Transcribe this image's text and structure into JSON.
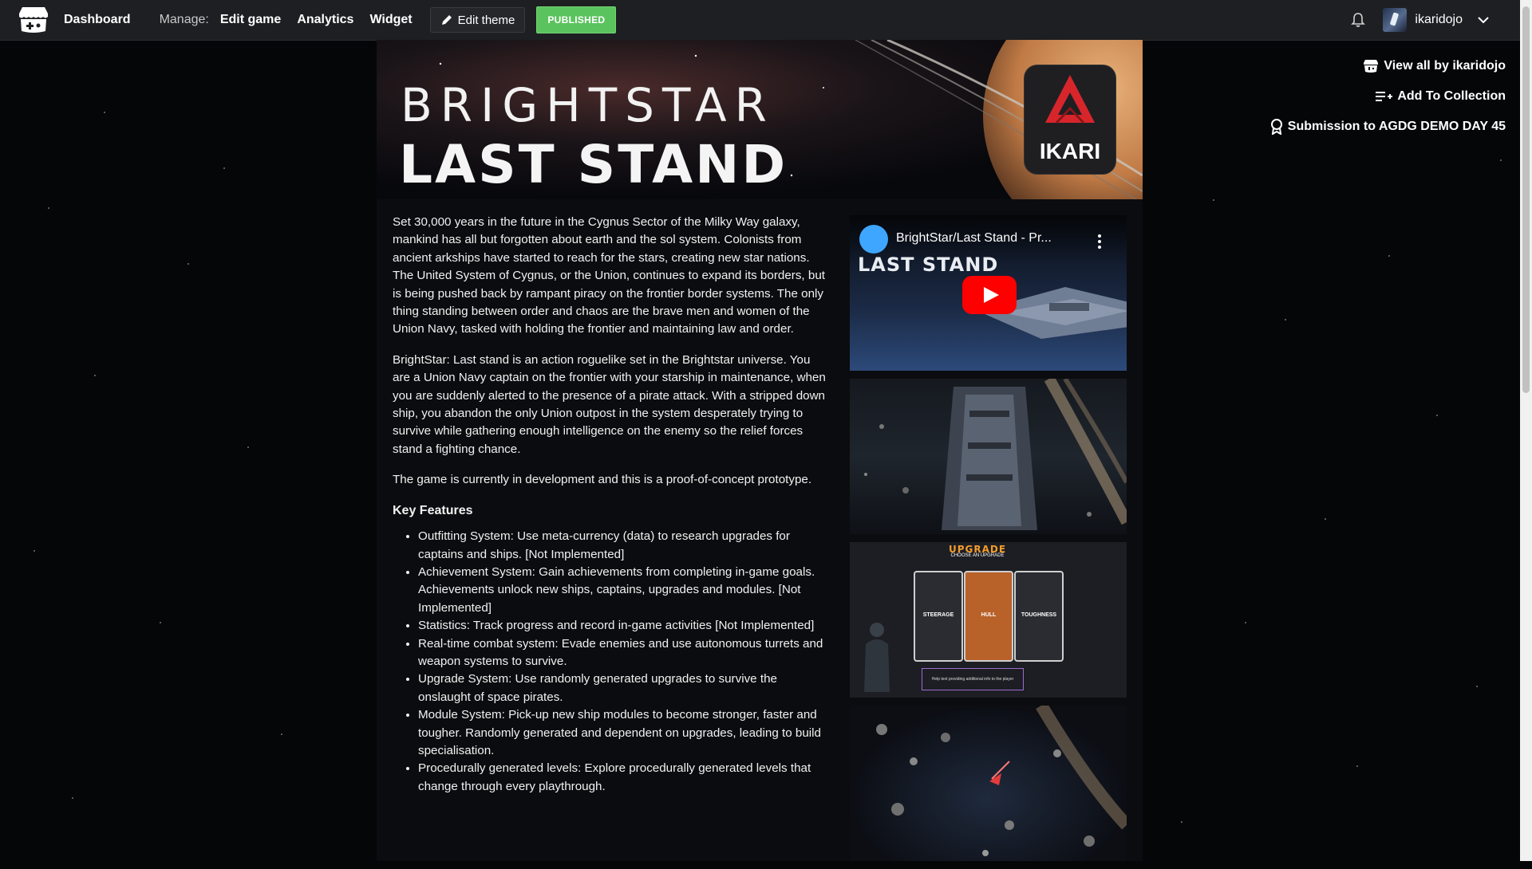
{
  "topbar": {
    "dashboard": "Dashboard",
    "manage_label": "Manage:",
    "edit_game": "Edit game",
    "analytics": "Analytics",
    "widget": "Widget",
    "edit_theme": "Edit theme",
    "status_badge": "PUBLISHED",
    "username": "ikaridojo"
  },
  "side_links": {
    "view_all": "View all by ikaridojo",
    "add_collection": "Add To Collection",
    "submission": "Submission to AGDG DEMO DAY 45"
  },
  "banner": {
    "line1": "BRIGHTSTAR",
    "line2": "LAST STAND",
    "studio": "IKARI"
  },
  "description": {
    "p1": "Set 30,000 years in the future in the Cygnus Sector of the Milky Way galaxy, mankind has all but forgotten about earth and the sol system. Colonists from ancient arkships have started to reach for the stars, creating new star nations. The United System of Cygnus, or the Union, continues to expand its borders, but is being pushed back by rampant piracy on the frontier border systems. The only thing standing between order and chaos are the brave men and women of the Union Navy, tasked with holding the frontier and maintaining law and order.",
    "p2": "BrightStar: Last stand is an action roguelike set in the Brightstar universe. You are a Union Navy captain on the frontier with your starship in maintenance, when you are suddenly alerted to the presence of a pirate attack. With a stripped down ship, you abandon the only Union outpost in the system desperately trying to survive while gathering enough intelligence on the enemy so the relief forces stand a fighting chance.",
    "p3": "The game is currently in development and this is a proof-of-concept prototype.",
    "features_heading": "Key Features",
    "features": [
      "Outfitting System: Use meta-currency (data) to research upgrades for captains and ships. [Not Implemented]",
      "Achievement System: Gain achievements from completing in-game goals. Achievements unlock new ships, captains, upgrades and modules. [Not Implemented]",
      "Statistics: Track progress and record in-game activities [Not Implemented]",
      "Real-time combat system: Evade enemies and use autonomous turrets and weapon systems to survive.",
      "Upgrade System: Use randomly generated upgrades to survive the onslaught of space pirates.",
      "Module System: Pick-up new ship modules to become stronger, faster and tougher. Randomly generated and dependent on upgrades, leading to build specialisation.",
      "Procedurally generated levels: Explore procedurally generated levels that change through every playthrough."
    ]
  },
  "video": {
    "title": "BrightStar/Last Stand - Pr...",
    "overlay_text": "LAST STAND"
  },
  "upgrade_screenshot": {
    "title": "UPGRADE",
    "subtitle": "CHOOSE AN UPGRADE",
    "cards": [
      "STEERAGE",
      "HULL",
      "TOUGHNESS"
    ],
    "help_text": "Help text providing additional info to the player"
  },
  "colors": {
    "topbar_bg": "#1e1f22",
    "published_green": "#5bc35e",
    "page_bg": "#0b0c0f",
    "ikari_red": "#d7262b",
    "youtube_red": "#ff0000"
  }
}
